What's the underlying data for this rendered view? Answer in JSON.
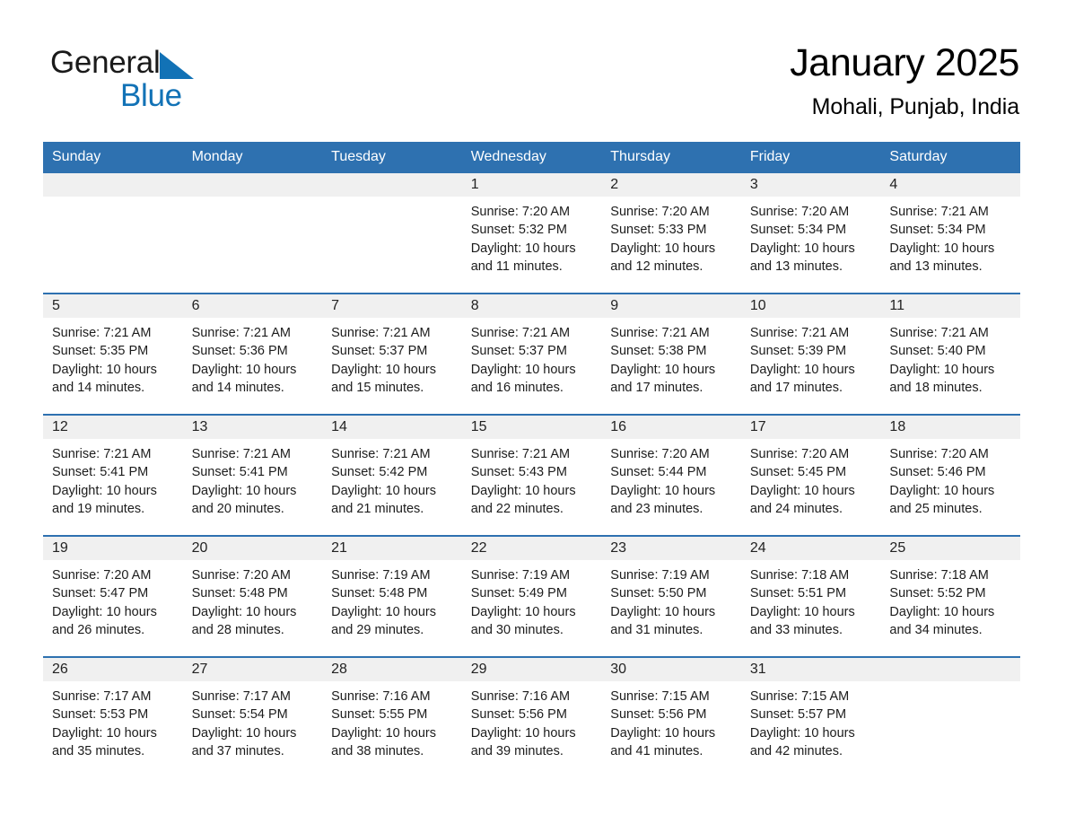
{
  "brand": {
    "name_part1": "General",
    "name_part2": "Blue",
    "triangle_icon": "triangle-icon",
    "accent_color": "#1272b6"
  },
  "header": {
    "title": "January 2025",
    "subtitle": "Mohali, Punjab, India"
  },
  "calendar": {
    "header_color": "#2e71b0",
    "daynum_band_color": "#f0f0f0",
    "weekdays": [
      "Sunday",
      "Monday",
      "Tuesday",
      "Wednesday",
      "Thursday",
      "Friday",
      "Saturday"
    ],
    "weeks": [
      [
        {
          "day": "",
          "empty": true
        },
        {
          "day": "",
          "empty": true
        },
        {
          "day": "",
          "empty": true
        },
        {
          "day": "1",
          "sunrise": "Sunrise: 7:20 AM",
          "sunset": "Sunset: 5:32 PM",
          "daylight1": "Daylight: 10 hours",
          "daylight2": "and 11 minutes."
        },
        {
          "day": "2",
          "sunrise": "Sunrise: 7:20 AM",
          "sunset": "Sunset: 5:33 PM",
          "daylight1": "Daylight: 10 hours",
          "daylight2": "and 12 minutes."
        },
        {
          "day": "3",
          "sunrise": "Sunrise: 7:20 AM",
          "sunset": "Sunset: 5:34 PM",
          "daylight1": "Daylight: 10 hours",
          "daylight2": "and 13 minutes."
        },
        {
          "day": "4",
          "sunrise": "Sunrise: 7:21 AM",
          "sunset": "Sunset: 5:34 PM",
          "daylight1": "Daylight: 10 hours",
          "daylight2": "and 13 minutes."
        }
      ],
      [
        {
          "day": "5",
          "sunrise": "Sunrise: 7:21 AM",
          "sunset": "Sunset: 5:35 PM",
          "daylight1": "Daylight: 10 hours",
          "daylight2": "and 14 minutes."
        },
        {
          "day": "6",
          "sunrise": "Sunrise: 7:21 AM",
          "sunset": "Sunset: 5:36 PM",
          "daylight1": "Daylight: 10 hours",
          "daylight2": "and 14 minutes."
        },
        {
          "day": "7",
          "sunrise": "Sunrise: 7:21 AM",
          "sunset": "Sunset: 5:37 PM",
          "daylight1": "Daylight: 10 hours",
          "daylight2": "and 15 minutes."
        },
        {
          "day": "8",
          "sunrise": "Sunrise: 7:21 AM",
          "sunset": "Sunset: 5:37 PM",
          "daylight1": "Daylight: 10 hours",
          "daylight2": "and 16 minutes."
        },
        {
          "day": "9",
          "sunrise": "Sunrise: 7:21 AM",
          "sunset": "Sunset: 5:38 PM",
          "daylight1": "Daylight: 10 hours",
          "daylight2": "and 17 minutes."
        },
        {
          "day": "10",
          "sunrise": "Sunrise: 7:21 AM",
          "sunset": "Sunset: 5:39 PM",
          "daylight1": "Daylight: 10 hours",
          "daylight2": "and 17 minutes."
        },
        {
          "day": "11",
          "sunrise": "Sunrise: 7:21 AM",
          "sunset": "Sunset: 5:40 PM",
          "daylight1": "Daylight: 10 hours",
          "daylight2": "and 18 minutes."
        }
      ],
      [
        {
          "day": "12",
          "sunrise": "Sunrise: 7:21 AM",
          "sunset": "Sunset: 5:41 PM",
          "daylight1": "Daylight: 10 hours",
          "daylight2": "and 19 minutes."
        },
        {
          "day": "13",
          "sunrise": "Sunrise: 7:21 AM",
          "sunset": "Sunset: 5:41 PM",
          "daylight1": "Daylight: 10 hours",
          "daylight2": "and 20 minutes."
        },
        {
          "day": "14",
          "sunrise": "Sunrise: 7:21 AM",
          "sunset": "Sunset: 5:42 PM",
          "daylight1": "Daylight: 10 hours",
          "daylight2": "and 21 minutes."
        },
        {
          "day": "15",
          "sunrise": "Sunrise: 7:21 AM",
          "sunset": "Sunset: 5:43 PM",
          "daylight1": "Daylight: 10 hours",
          "daylight2": "and 22 minutes."
        },
        {
          "day": "16",
          "sunrise": "Sunrise: 7:20 AM",
          "sunset": "Sunset: 5:44 PM",
          "daylight1": "Daylight: 10 hours",
          "daylight2": "and 23 minutes."
        },
        {
          "day": "17",
          "sunrise": "Sunrise: 7:20 AM",
          "sunset": "Sunset: 5:45 PM",
          "daylight1": "Daylight: 10 hours",
          "daylight2": "and 24 minutes."
        },
        {
          "day": "18",
          "sunrise": "Sunrise: 7:20 AM",
          "sunset": "Sunset: 5:46 PM",
          "daylight1": "Daylight: 10 hours",
          "daylight2": "and 25 minutes."
        }
      ],
      [
        {
          "day": "19",
          "sunrise": "Sunrise: 7:20 AM",
          "sunset": "Sunset: 5:47 PM",
          "daylight1": "Daylight: 10 hours",
          "daylight2": "and 26 minutes."
        },
        {
          "day": "20",
          "sunrise": "Sunrise: 7:20 AM",
          "sunset": "Sunset: 5:48 PM",
          "daylight1": "Daylight: 10 hours",
          "daylight2": "and 28 minutes."
        },
        {
          "day": "21",
          "sunrise": "Sunrise: 7:19 AM",
          "sunset": "Sunset: 5:48 PM",
          "daylight1": "Daylight: 10 hours",
          "daylight2": "and 29 minutes."
        },
        {
          "day": "22",
          "sunrise": "Sunrise: 7:19 AM",
          "sunset": "Sunset: 5:49 PM",
          "daylight1": "Daylight: 10 hours",
          "daylight2": "and 30 minutes."
        },
        {
          "day": "23",
          "sunrise": "Sunrise: 7:19 AM",
          "sunset": "Sunset: 5:50 PM",
          "daylight1": "Daylight: 10 hours",
          "daylight2": "and 31 minutes."
        },
        {
          "day": "24",
          "sunrise": "Sunrise: 7:18 AM",
          "sunset": "Sunset: 5:51 PM",
          "daylight1": "Daylight: 10 hours",
          "daylight2": "and 33 minutes."
        },
        {
          "day": "25",
          "sunrise": "Sunrise: 7:18 AM",
          "sunset": "Sunset: 5:52 PM",
          "daylight1": "Daylight: 10 hours",
          "daylight2": "and 34 minutes."
        }
      ],
      [
        {
          "day": "26",
          "sunrise": "Sunrise: 7:17 AM",
          "sunset": "Sunset: 5:53 PM",
          "daylight1": "Daylight: 10 hours",
          "daylight2": "and 35 minutes."
        },
        {
          "day": "27",
          "sunrise": "Sunrise: 7:17 AM",
          "sunset": "Sunset: 5:54 PM",
          "daylight1": "Daylight: 10 hours",
          "daylight2": "and 37 minutes."
        },
        {
          "day": "28",
          "sunrise": "Sunrise: 7:16 AM",
          "sunset": "Sunset: 5:55 PM",
          "daylight1": "Daylight: 10 hours",
          "daylight2": "and 38 minutes."
        },
        {
          "day": "29",
          "sunrise": "Sunrise: 7:16 AM",
          "sunset": "Sunset: 5:56 PM",
          "daylight1": "Daylight: 10 hours",
          "daylight2": "and 39 minutes."
        },
        {
          "day": "30",
          "sunrise": "Sunrise: 7:15 AM",
          "sunset": "Sunset: 5:56 PM",
          "daylight1": "Daylight: 10 hours",
          "daylight2": "and 41 minutes."
        },
        {
          "day": "31",
          "sunrise": "Sunrise: 7:15 AM",
          "sunset": "Sunset: 5:57 PM",
          "daylight1": "Daylight: 10 hours",
          "daylight2": "and 42 minutes."
        },
        {
          "day": "",
          "empty": true
        }
      ]
    ]
  }
}
